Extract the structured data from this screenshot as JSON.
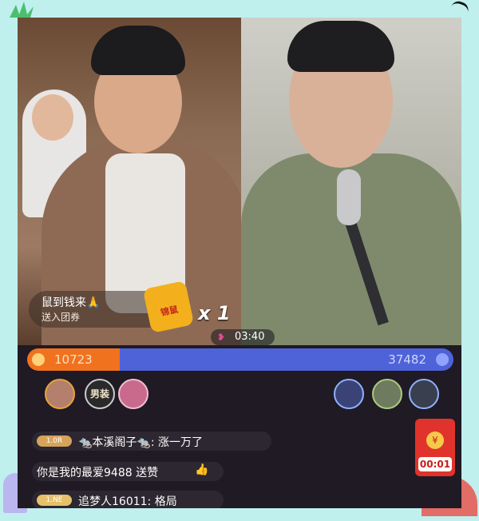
{
  "stream": {
    "gift_promo": {
      "title": "鼠到钱来🙏",
      "subtitle": "送入团券",
      "box_label": "锦鼠"
    },
    "gift_multiplier": "x 1",
    "timer": "03:40",
    "scores": {
      "left": "10723",
      "right": "37482"
    },
    "badge_text": "男装"
  },
  "comments": [
    {
      "level": "1.0R",
      "text": "🐀本溪阁子🐀: 涨一万了"
    },
    {
      "level": "",
      "text": "你是我的最爱9488 送赞"
    },
    {
      "level": "1.NE",
      "text": "追梦人16011: 格局"
    }
  ],
  "red_packet": {
    "time": "00:01"
  },
  "icons": {
    "timer": "heart-arc-icon",
    "like": "thumb-icon",
    "packet": "coin-icon"
  },
  "colors": {
    "left_team": "#f0721f",
    "right_team": "#4f63d8",
    "background": "#bff0ee"
  }
}
